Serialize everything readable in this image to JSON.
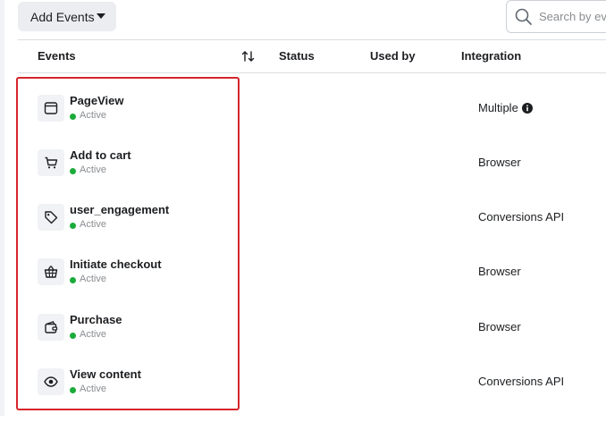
{
  "toolbar": {
    "add_events_label": "Add Events",
    "search_placeholder": "Search by ev"
  },
  "table": {
    "columns": [
      "Events",
      "Status",
      "Used by",
      "Integration"
    ],
    "rows": [
      {
        "name": "PageView",
        "status": "Active",
        "integration": "Multiple",
        "icon": "browser-window-icon",
        "has_info": true
      },
      {
        "name": "Add to cart",
        "status": "Active",
        "integration": "Browser",
        "icon": "cart-icon",
        "has_info": false
      },
      {
        "name": "user_engagement",
        "status": "Active",
        "integration": "Conversions API",
        "icon": "tag-icon",
        "has_info": false
      },
      {
        "name": "Initiate checkout",
        "status": "Active",
        "integration": "Browser",
        "icon": "basket-icon",
        "has_info": false
      },
      {
        "name": "Purchase",
        "status": "Active",
        "integration": "Browser",
        "icon": "wallet-icon",
        "has_info": false
      },
      {
        "name": "View content",
        "status": "Active",
        "integration": "Conversions API",
        "icon": "eye-icon",
        "has_info": false
      }
    ]
  },
  "colors": {
    "active": "#1bab3a",
    "highlight": "#d6262c",
    "button_bg": "#ebedf0"
  }
}
